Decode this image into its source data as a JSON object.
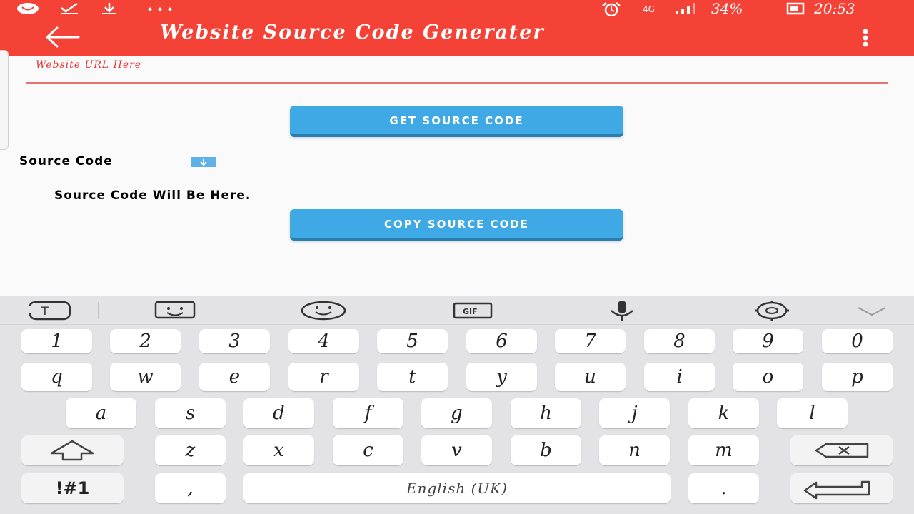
{
  "status_bar": {
    "battery": "34%",
    "time": "20:53",
    "network": "4G"
  },
  "app_bar": {
    "title": "Website Source Code Generater"
  },
  "form": {
    "url_hint": "Website URL Here",
    "get_button": "GET SOURCE CODE",
    "section_label": "Source Code",
    "output_placeholder": "Source Code Will Be Here.",
    "copy_button": "COPY SOURCE CODE"
  },
  "keyboard": {
    "toolbar_icons": [
      "text-mode-icon",
      "sticker-icon",
      "emoji-icon",
      "gif-icon",
      "microphone-icon",
      "settings-gear-icon",
      "collapse-keyboard-icon"
    ],
    "row_numbers": [
      "1",
      "2",
      "3",
      "4",
      "5",
      "6",
      "7",
      "8",
      "9",
      "0"
    ],
    "row_top": [
      "q",
      "w",
      "e",
      "r",
      "t",
      "y",
      "u",
      "i",
      "o",
      "p"
    ],
    "row_middle": [
      "a",
      "s",
      "d",
      "f",
      "g",
      "h",
      "j",
      "k",
      "l"
    ],
    "row_bottom": [
      "z",
      "x",
      "c",
      "v",
      "b",
      "n",
      "m"
    ],
    "symbols_key": "!#1",
    "comma_key": ",",
    "space_key": "English (UK)",
    "period_key": "."
  },
  "colors": {
    "primary": "#f44336",
    "button": "#3fa9e6",
    "keyboard_bg": "#e3e3e5"
  }
}
